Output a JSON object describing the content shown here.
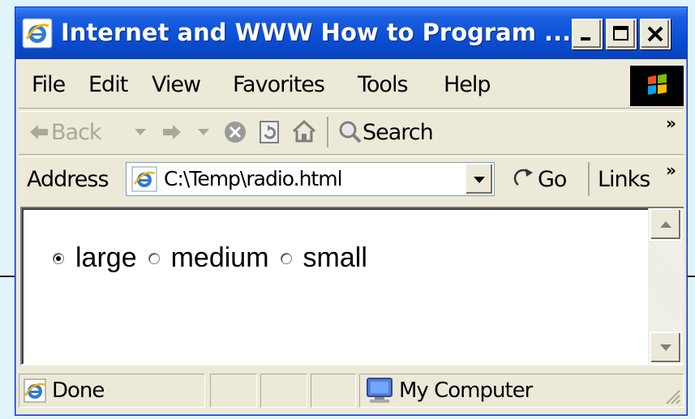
{
  "window": {
    "title": "Internet and WWW How to Program ...",
    "controls": {
      "minimize": "_",
      "maximize": "□",
      "close": "✕"
    }
  },
  "menubar": {
    "items": [
      {
        "label": "File",
        "mnemonic": "F"
      },
      {
        "label": "Edit",
        "mnemonic": "E"
      },
      {
        "label": "View",
        "mnemonic": "V"
      },
      {
        "label": "Favorites",
        "mnemonic": "a"
      },
      {
        "label": "Tools",
        "mnemonic": "T"
      },
      {
        "label": "Help",
        "mnemonic": "H"
      }
    ]
  },
  "toolbar": {
    "back_label": "Back",
    "search_label": "Search",
    "overflow": "»"
  },
  "addressbar": {
    "label": "Address",
    "url": "C:\\Temp\\radio.html",
    "go_label": "Go",
    "links_label": "Links",
    "links_overflow": "»"
  },
  "content": {
    "radio_options": [
      {
        "label": "large",
        "checked": true
      },
      {
        "label": "medium",
        "checked": false
      },
      {
        "label": "small",
        "checked": false
      }
    ]
  },
  "statusbar": {
    "status_text": "Done",
    "zone_text": "My Computer"
  },
  "colors": {
    "titlebar": "#0a4fd6",
    "chrome": "#ece9d8",
    "slide_background": "#dff4fb"
  }
}
